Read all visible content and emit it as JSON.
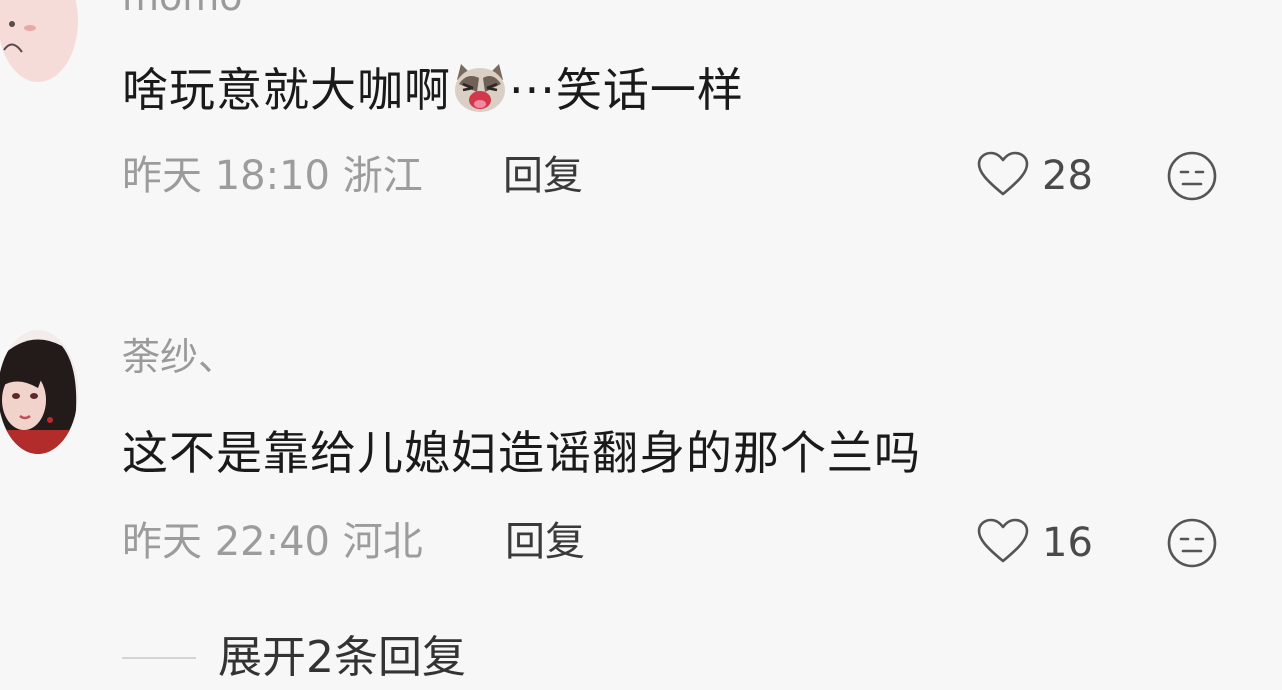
{
  "comments": [
    {
      "username": "momo",
      "text_before_emoji": "啥玩意就大咖啊",
      "emoji": "cat-crying-emoji",
      "text_after_emoji": "···笑话一样",
      "date": "昨天",
      "time": "18:10",
      "location": "浙江",
      "reply_label": "回复",
      "like_count": "28",
      "like_icon": "heart-outline-icon",
      "dislike_icon": "neutral-face-icon"
    },
    {
      "username": "荼纱、",
      "text": "这不是靠给儿媳妇造谣翻身的那个兰吗",
      "date": "昨天",
      "time": "22:40",
      "location": "河北",
      "reply_label": "回复",
      "like_count": "16",
      "like_icon": "heart-outline-icon",
      "dislike_icon": "neutral-face-icon",
      "expand_replies_label": "展开2条回复"
    }
  ],
  "colors": {
    "background": "#f7f7f7",
    "username": "#9a9a9a",
    "text": "#1a1a1a",
    "meta": "#9c9c9c",
    "icon": "#555555"
  }
}
